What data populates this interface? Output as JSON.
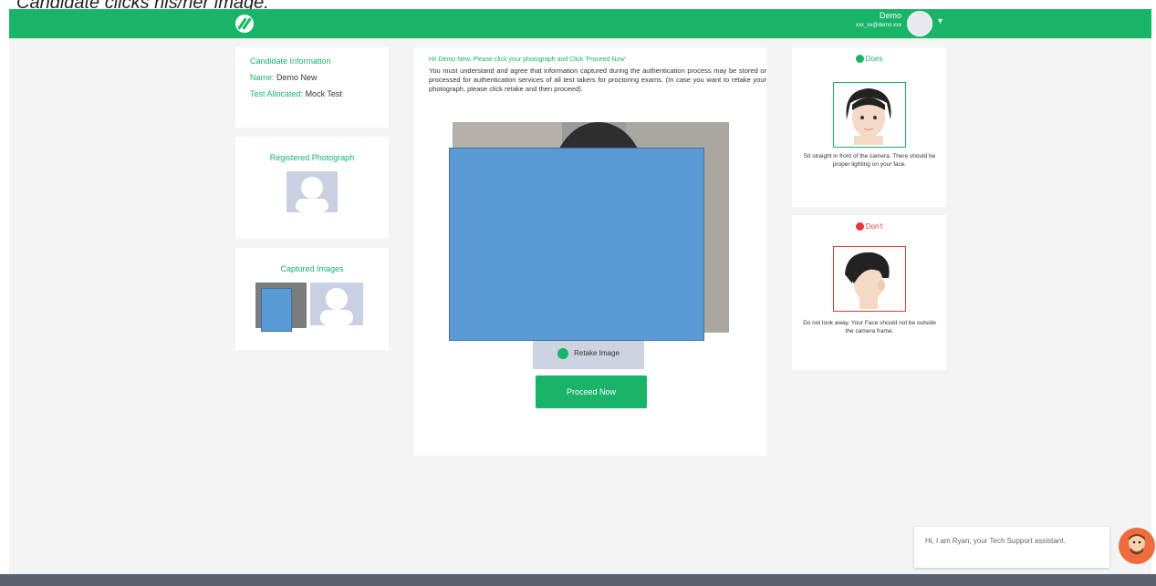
{
  "caption": "Candidate clicks his/her image.",
  "header": {
    "user_name": "Demo",
    "user_email": "xxx_xx@demo.xxx",
    "caret": "▾"
  },
  "candidate_info": {
    "title": "Candidate Information",
    "name_label": "Name:",
    "name_value": "Demo New",
    "test_label": "Test Allocated:",
    "test_value": "Mock Test"
  },
  "registered_photo": {
    "title": "Registered Photograph"
  },
  "captured_images": {
    "title": "Captured Images"
  },
  "main": {
    "title": "Hi! Demo New, Please click your photograph and Click 'Proceed Now'",
    "text": "You must understand and agree that information captured during the authentication process may be stored or processed for authentication services of all test takers for proctoring exams. (In case you want to retake your photograph, please click retake and then proceed).",
    "retake_label": "Retake Image",
    "proceed_label": "Proceed Now"
  },
  "do_panel": {
    "heading": "Does",
    "note": "Sit straight in front of the camera. There should be proper lighting on your face."
  },
  "dont_panel": {
    "heading": "Don't",
    "note": "Do not look away. Your Face should not be outside the camera frame."
  },
  "chat": {
    "message": "Hi, I am Ryan, your Tech Support assistant."
  },
  "colors": {
    "brand_green": "#19b467",
    "redaction_blue": "#5b9bd5",
    "dont_red": "#e53935"
  }
}
